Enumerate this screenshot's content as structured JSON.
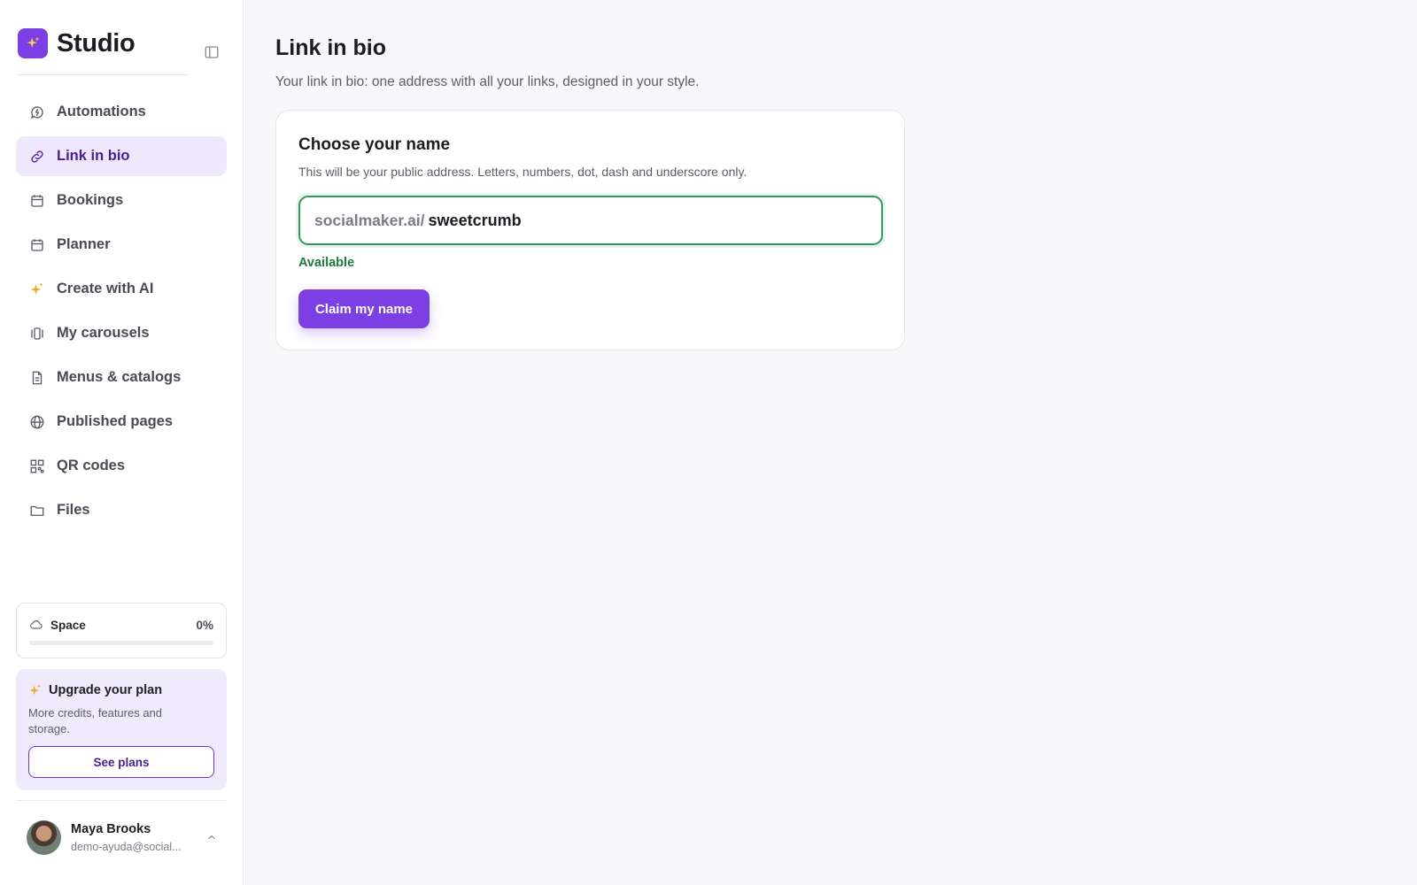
{
  "brand": {
    "name": "Studio"
  },
  "sidebar": {
    "items": [
      {
        "label": "Automations",
        "icon": "automation-icon",
        "active": false
      },
      {
        "label": "Link in bio",
        "icon": "link-icon",
        "active": true
      },
      {
        "label": "Bookings",
        "icon": "calendar-icon",
        "active": false
      },
      {
        "label": "Planner",
        "icon": "calendar-icon",
        "active": false
      },
      {
        "label": "Create with AI",
        "icon": "sparkles-icon",
        "active": false
      },
      {
        "label": "My carousels",
        "icon": "carousel-icon",
        "active": false
      },
      {
        "label": "Menus & catalogs",
        "icon": "document-icon",
        "active": false
      },
      {
        "label": "Published pages",
        "icon": "globe-icon",
        "active": false
      },
      {
        "label": "QR codes",
        "icon": "qr-code-icon",
        "active": false
      },
      {
        "label": "Files",
        "icon": "folder-icon",
        "active": false
      }
    ],
    "space": {
      "label": "Space",
      "percent_text": "0%",
      "fraction": 0
    },
    "upgrade": {
      "title": "Upgrade your plan",
      "description": "More credits, features and storage.",
      "button_label": "See plans"
    },
    "user": {
      "name": "Maya Brooks",
      "email": "demo-ayuda@social..."
    }
  },
  "main": {
    "title": "Link in bio",
    "subtitle": "Your link in bio: one address with all your links, designed in your style.",
    "card": {
      "title": "Choose your name",
      "description": "This will be your public address. Letters, numbers, dot, dash and underscore only.",
      "prefix": "socialmaker.ai/",
      "value": "sweetcrumb",
      "status": "Available",
      "button_label": "Claim my name"
    }
  },
  "colors": {
    "accent": "#7b3fe4",
    "accent_dark": "#4a1d96",
    "active_bg": "#efe8fd",
    "success": "#1f7a3f",
    "success_border": "#2f9a5a",
    "sparkle": "#f5a623"
  }
}
